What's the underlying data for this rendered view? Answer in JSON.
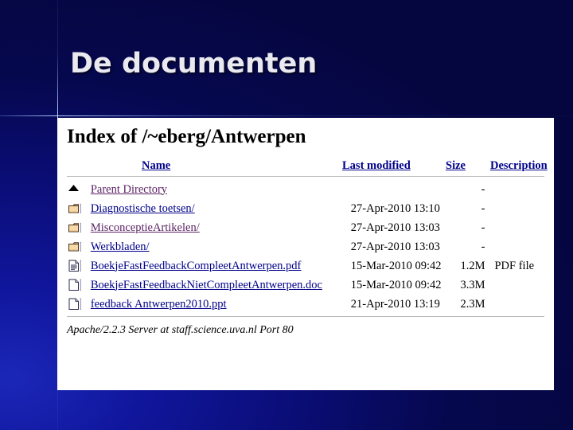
{
  "slide": {
    "title": "De documenten",
    "background_color": "#0a0d75",
    "accent_color": "#bcd2ff"
  },
  "index": {
    "heading": "Index of /~eberg/Antwerpen",
    "columns": {
      "name": "Name",
      "last_modified": "Last modified",
      "size": "Size",
      "description": "Description"
    },
    "parent": {
      "icon": "up-triangle-icon",
      "label": "Parent Directory",
      "last_modified": "",
      "size": "-",
      "description": "",
      "visited": true
    },
    "rows": [
      {
        "icon": "folder-icon",
        "name": "Diagnostische toetsen/",
        "last_modified": "27-Apr-2010 13:10",
        "size": "-",
        "description": "",
        "visited": false
      },
      {
        "icon": "folder-icon",
        "name": "MisconceptieArtikelen/",
        "last_modified": "27-Apr-2010 13:03",
        "size": "-",
        "description": "",
        "visited": true
      },
      {
        "icon": "folder-icon",
        "name": "Werkbladen/",
        "last_modified": "27-Apr-2010 13:03",
        "size": "-",
        "description": "",
        "visited": false
      },
      {
        "icon": "text-document-icon",
        "name": "BoekjeFastFeedbackCompleetAntwerpen.pdf",
        "last_modified": "15-Mar-2010 09:42",
        "size": "1.2M",
        "description": "PDF file",
        "visited": false
      },
      {
        "icon": "blank-document-icon",
        "name": "BoekjeFastFeedbackNietCompleetAntwerpen.doc",
        "last_modified": "15-Mar-2010 09:42",
        "size": "3.3M",
        "description": "",
        "visited": false
      },
      {
        "icon": "blank-document-icon",
        "name": "feedback Antwerpen2010.ppt",
        "last_modified": "21-Apr-2010 13:19",
        "size": "2.3M",
        "description": "",
        "visited": false
      }
    ],
    "footer": "Apache/2.2.3 Server at staff.science.uva.nl Port 80"
  }
}
